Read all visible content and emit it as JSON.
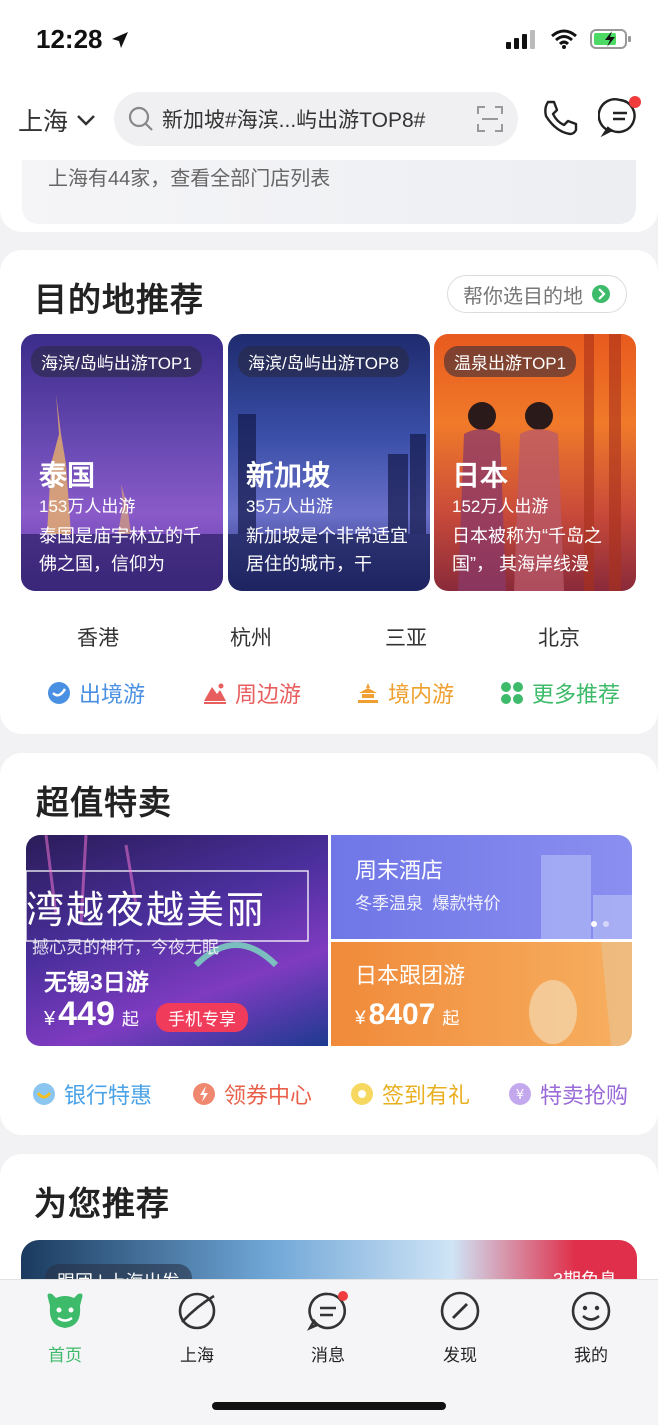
{
  "status_bar": {
    "time": "12:28"
  },
  "header": {
    "city": "上海",
    "search_text": "新加坡#海滨...屿出游TOP8#"
  },
  "store": {
    "text": "上海有44家，查看全部门店列表"
  },
  "destinations": {
    "title": "目的地推荐",
    "help_label": "帮你选目的地",
    "cards": [
      {
        "tag": "海滨/岛屿出游TOP1",
        "name": "泰国",
        "count": "153万人出游",
        "desc": "泰国是庙宇林立的千佛之国，信仰为"
      },
      {
        "tag": "海滨/岛屿出游TOP8",
        "name": "新加坡",
        "count": "35万人出游",
        "desc": "新加坡是个非常适宜居住的城市，干"
      },
      {
        "tag": "温泉出游TOP1",
        "name": "日本",
        "count": "152万人出游",
        "desc": "日本被称为“千岛之国”， 其海岸线漫"
      }
    ],
    "cities": [
      "香港",
      "杭州",
      "三亚",
      "北京"
    ],
    "categories": [
      {
        "label": "出境游",
        "color": "#4a90e2",
        "icon": "globe-icon"
      },
      {
        "label": "周边游",
        "color": "#e85d5d",
        "icon": "mountain-icon"
      },
      {
        "label": "境内游",
        "color": "#f0a030",
        "icon": "temple-icon"
      },
      {
        "label": "更多推荐",
        "color": "#3dbb6a",
        "icon": "grid-icon"
      }
    ]
  },
  "deals": {
    "title": "超值特卖",
    "big": {
      "overlay_title": "湾越夜越美丽",
      "overlay_sub": "撼心灵的神行，今夜无眠",
      "name": "无锡3日游",
      "currency": "¥",
      "price": "449",
      "suffix": "起",
      "badge": "手机专享"
    },
    "hotel": {
      "name": "周末酒店",
      "sub": "冬季温泉  爆款特价"
    },
    "tour": {
      "name": "日本跟团游",
      "currency": "¥",
      "price": "8407",
      "suffix": "起"
    },
    "perks": [
      {
        "label": "银行特惠",
        "color": "#4aa3e8"
      },
      {
        "label": "领券中心",
        "color": "#e8604a"
      },
      {
        "label": "签到有礼",
        "color": "#e8b020"
      },
      {
        "label": "特卖抢购",
        "color": "#9a6ad8"
      }
    ]
  },
  "recommend": {
    "title": "为您推荐",
    "banner_tag": "跟团 | 上海出发",
    "banner_right": "3期免息"
  },
  "tabbar": [
    {
      "label": "首页",
      "active": true,
      "icon": "home-cow-icon"
    },
    {
      "label": "上海",
      "active": false,
      "icon": "planet-icon"
    },
    {
      "label": "消息",
      "active": false,
      "icon": "message-icon"
    },
    {
      "label": "发现",
      "active": false,
      "icon": "compass-icon"
    },
    {
      "label": "我的",
      "active": false,
      "icon": "profile-icon"
    }
  ],
  "colors": {
    "brand_green": "#3dbb6a",
    "badge_red": "#f03c3c"
  }
}
